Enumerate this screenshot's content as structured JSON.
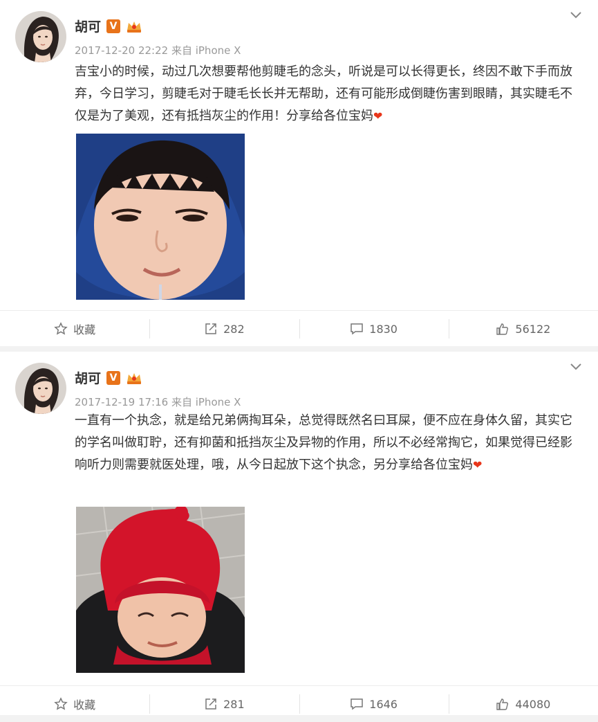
{
  "posts": [
    {
      "author": "胡可",
      "verified_badge": "V",
      "time": "2017-12-20 22:22",
      "source": "来自 iPhone X",
      "text": "吉宝小的时候，动过几次想要帮他剪睫毛的念头，听说是可以长得更长，终因不敢下手而放弃，今日学习，剪睫毛对于睫毛长长并无帮助，还有可能形成倒睫伤害到眼睛，其实睫毛不仅是为了美观，还有抵挡灰尘的作用！分享给各位宝妈",
      "emoji": "❤",
      "actions": {
        "favorite": "收藏",
        "repost": "282",
        "comment": "1830",
        "like": "56122"
      }
    },
    {
      "author": "胡可",
      "verified_badge": "V",
      "time": "2017-12-19 17:16",
      "source": "来自 iPhone X",
      "text": "一直有一个执念，就是给兄弟俩掏耳朵，总觉得既然名曰耳屎，便不应在身体久留，其实它的学名叫做耵聍，还有抑菌和抵挡灰尘及异物的作用，所以不必经常掏它，如果觉得已经影响听力则需要就医处理，哦，从今日起放下这个执念，另分享给各位宝妈",
      "emoji": "❤",
      "actions": {
        "favorite": "收藏",
        "repost": "281",
        "comment": "1646",
        "like": "44080"
      }
    }
  ],
  "icons": {
    "chevron": "chevron-down-icon",
    "favorite": "star-icon",
    "repost": "repost-icon",
    "comment": "comment-icon",
    "like": "thumbs-up-icon"
  },
  "colors": {
    "accent_orange": "#e8731a",
    "heart_red": "#e8361b",
    "text": "#333333",
    "meta": "#999999"
  }
}
